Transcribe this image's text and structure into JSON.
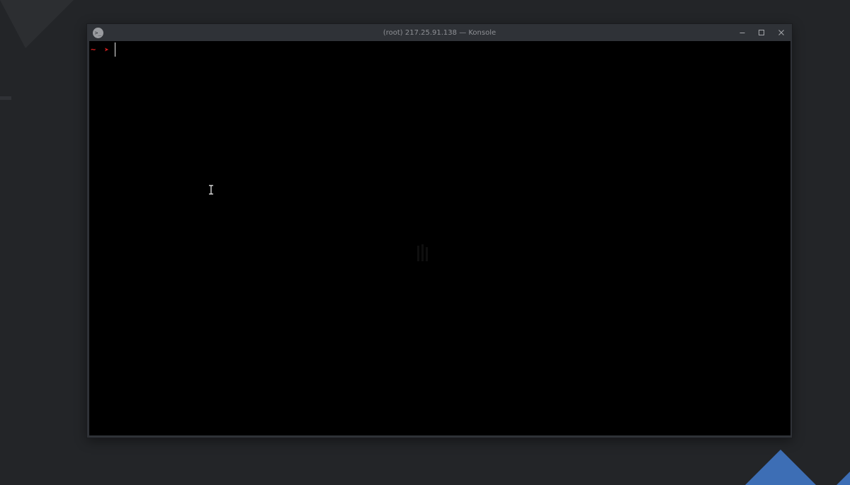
{
  "window": {
    "title": "(root) 217.25.91.138 — Konsole",
    "app_icon": "konsole-icon",
    "controls": {
      "minimize_icon": "minimize-icon",
      "maximize_icon": "maximize-icon",
      "close_icon": "close-icon"
    }
  },
  "terminal": {
    "prompt_dir": "~",
    "prompt_symbol": "➤",
    "input_value": "",
    "prompt_color": "#d11f1f",
    "background": "#000000"
  },
  "wallpaper": {
    "accent_color": "#3d6eb5"
  }
}
